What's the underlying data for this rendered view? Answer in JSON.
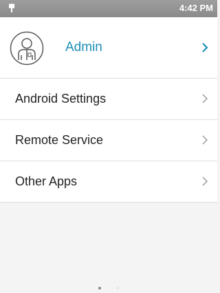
{
  "status_bar": {
    "time": "4:42 PM",
    "left_icon": "usb-icon"
  },
  "profile": {
    "name": "Admin",
    "avatar_icon": "user-avatar-icon",
    "accent_color": "#1e8fb6"
  },
  "menu": {
    "items": [
      {
        "label": "Android Settings"
      },
      {
        "label": "Remote Service"
      },
      {
        "label": "Other Apps"
      }
    ]
  },
  "pager": {
    "pages": 2,
    "active_page": 1
  }
}
